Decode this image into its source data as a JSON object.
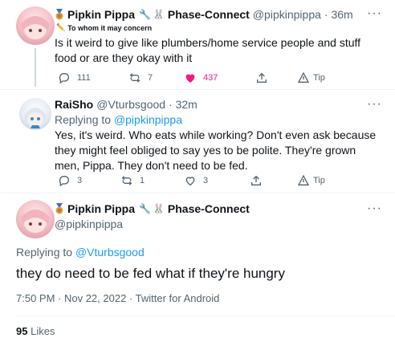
{
  "tweet1": {
    "display_name": "Pipkin Pippa",
    "affiliation": "Phase-Connect",
    "handle": "@pipkinpippa",
    "time": "· 36m",
    "label": "To whom it may concern",
    "text": "Is it weird to give like plumbers/home service people and stuff food or are they okay with it",
    "replies": "111",
    "retweets": "7",
    "likes": "437",
    "tip": "Tip"
  },
  "tweet2": {
    "display_name": "RaiSho",
    "handle": "@Vturbsgood",
    "time": "· 32m",
    "replying_prefix": "Replying to",
    "replying_to": "@pipkinpippa",
    "text": "Yes, it's weird. Who eats while working? Don't even ask because they might feel obliged to say yes to be polite. They're grown men, Pippa. They don't need to be fed.",
    "replies": "3",
    "retweets": "1",
    "likes": "3",
    "tip": "Tip"
  },
  "tweet3": {
    "display_name": "Pipkin Pippa",
    "affiliation": "Phase-Connect",
    "handle": "@pipkinpippa",
    "replying_prefix": "Replying to",
    "replying_to": "@Vturbsgood",
    "text": "they do need to be fed what if they're hungry",
    "meta": "7:50 PM · Nov 22, 2022 · Twitter for Android",
    "likes_count": "95",
    "likes_label": "Likes"
  },
  "more_label": "···",
  "colors": {
    "like_active": "#f91880",
    "link": "#1d9bf0",
    "muted": "#536471"
  }
}
